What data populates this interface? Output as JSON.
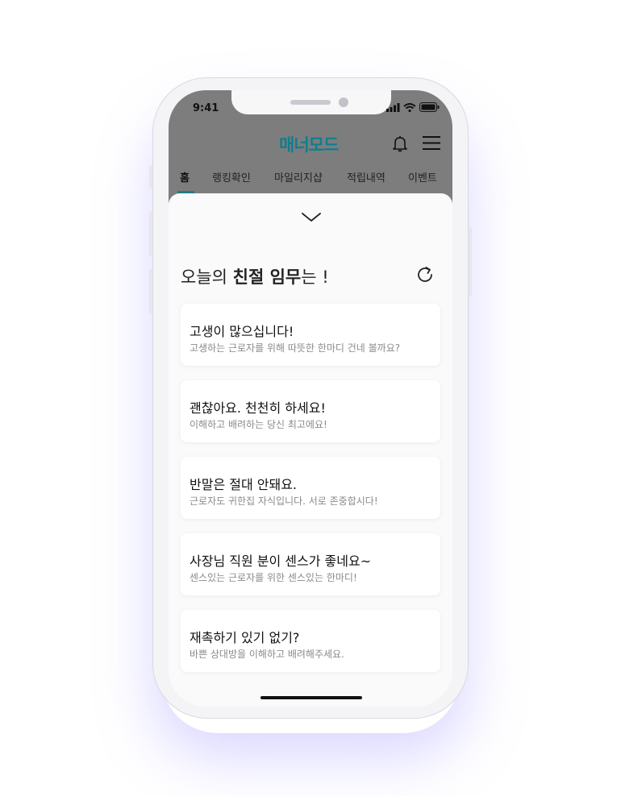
{
  "status_bar": {
    "time": "9:41"
  },
  "header": {
    "logo": "매너모드",
    "icons": [
      "bell-icon",
      "menu-icon"
    ],
    "accent_color": "#0e7e8e"
  },
  "tabs": [
    {
      "label": "홈",
      "active": true
    },
    {
      "label": "랭킹확인",
      "active": false
    },
    {
      "label": "마일리지샵",
      "active": false
    },
    {
      "label": "적립내역",
      "active": false
    },
    {
      "label": "이벤트",
      "active": false
    }
  ],
  "mission": {
    "heading_prefix": "오늘의 ",
    "heading_bold": "친절 임무",
    "heading_suffix": "는 !",
    "cards": [
      {
        "title": "고생이 많으십니다!",
        "subtitle": "고생하는 근로자를 위해 따뜻한 한마디 건네 볼까요?"
      },
      {
        "title": "괜찮아요. 천천히 하세요!",
        "subtitle": "이해하고 배려하는 당신 최고에요!"
      },
      {
        "title": "반말은 절대 안돼요.",
        "subtitle": "근로자도 귀한집 자식입니다. 서로 존중합시다!"
      },
      {
        "title": "사장님 직원 분이 센스가 좋네요~",
        "subtitle": "센스있는 근로자를 위한 센스있는 한마디!"
      },
      {
        "title": "재촉하기 있기 없기?",
        "subtitle": "바쁜 상대방을 이해하고 배려해주세요."
      }
    ]
  }
}
